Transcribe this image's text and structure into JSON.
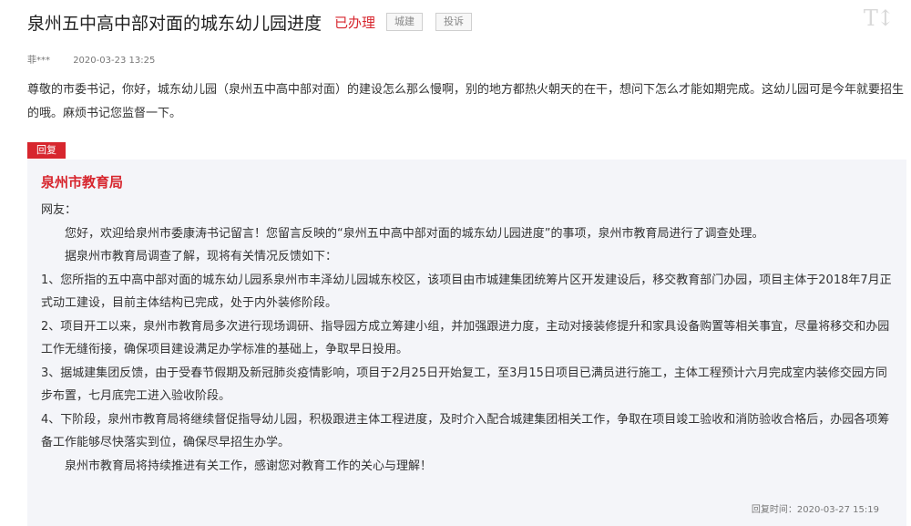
{
  "header": {
    "title": "泉州五中高中部对面的城东幼儿园进度",
    "status": "已办理",
    "tags": [
      "城建",
      "投诉"
    ],
    "font_toggle": "T↕"
  },
  "meta": {
    "author": "菲***",
    "time": "2020-03-23 13:25"
  },
  "message": "尊敬的市委书记，你好，城东幼儿园（泉州五中高中部对面）的建设怎么那么慢啊，别的地方都热火朝天的在干，想问下怎么才能如期完成。这幼儿园可是今年就要招生的哦。麻烦书记您监督一下。",
  "reply": {
    "label": "回复",
    "org": "泉州市教育局",
    "greeting": "网友：",
    "paragraphs": [
      "您好，欢迎给泉州市委康涛书记留言！您留言反映的“泉州五中高中部对面的城东幼儿园进度”的事项，泉州市教育局进行了调查处理。",
      "据泉州市教育局调查了解，现将有关情况反馈如下：",
      "1、您所指的五中高中部对面的城东幼儿园系泉州市丰泽幼儿园城东校区，该项目由市城建集团统筹片区开发建设后，移交教育部门办园，项目主体于2018年7月正式动工建设，目前主体结构已完成，处于内外装修阶段。",
      "2、项目开工以来，泉州市教育局多次进行现场调研、指导园方成立筹建小组，并加强跟进力度，主动对接装修提升和家具设备购置等相关事宜，尽量将移交和办园工作无缝衔接，确保项目建设满足办学标准的基础上，争取早日投用。",
      "3、据城建集团反馈，由于受春节假期及新冠肺炎疫情影响，项目于2月25日开始复工，至3月15日项目已满员进行施工，主体工程预计六月完成室内装修交园方同步布置，七月底完工进入验收阶段。",
      "4、下阶段，泉州市教育局将继续督促指导幼儿园，积极跟进主体工程进度，及时介入配合城建集团相关工作，争取在项目竣工验收和消防验收合格后，办园各项筹备工作能够尽快落实到位，确保尽早招生办学。",
      "泉州市教育局将持续推进有关工作，感谢您对教育工作的关心与理解！"
    ],
    "time": "回复时间：2020-03-27 15:19"
  },
  "colors": {
    "accent": "#d7262e",
    "reply_bg": "#f4f5f9"
  }
}
